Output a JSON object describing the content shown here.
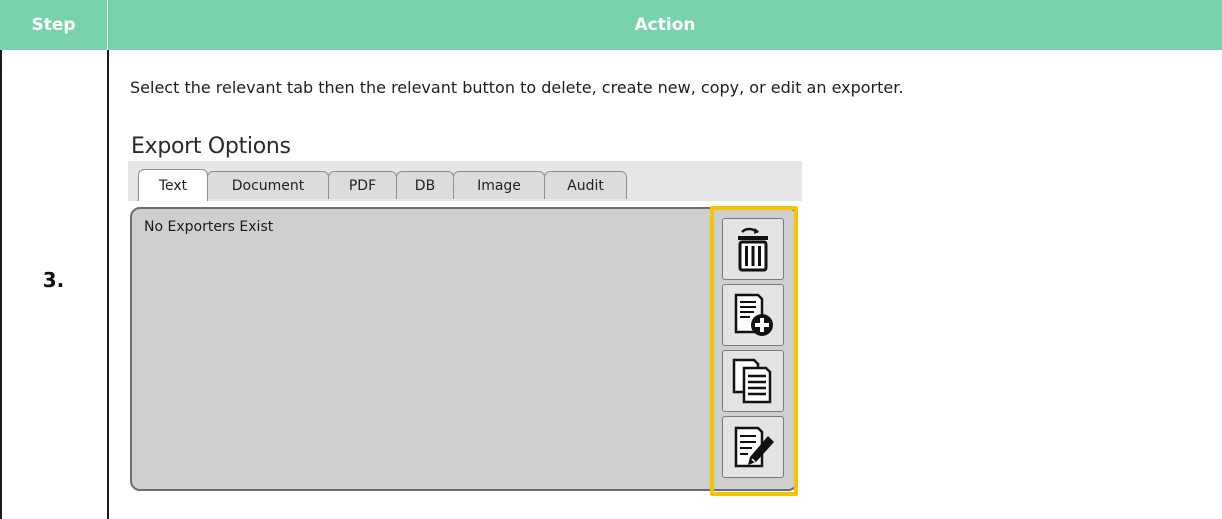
{
  "table": {
    "header_step": "Step",
    "header_action": "Action",
    "step_number": "3.",
    "instruction": "Select the relevant tab then the relevant button to delete, create new, copy, or edit an exporter."
  },
  "export_options": {
    "title": "Export Options",
    "tabs": [
      {
        "label": "Text",
        "active": true
      },
      {
        "label": "Document",
        "active": false
      },
      {
        "label": "PDF",
        "active": false
      },
      {
        "label": "DB",
        "active": false
      },
      {
        "label": "Image",
        "active": false
      },
      {
        "label": "Audit",
        "active": false
      }
    ],
    "empty_message": "No Exporters Exist",
    "buttons": [
      {
        "icon": "delete-icon"
      },
      {
        "icon": "new-document-icon"
      },
      {
        "icon": "copy-document-icon"
      },
      {
        "icon": "edit-document-icon"
      }
    ]
  },
  "colors": {
    "header_bg": "#78d3ab",
    "highlight": "#f5c400",
    "panel_bg": "#cfcfcf"
  }
}
